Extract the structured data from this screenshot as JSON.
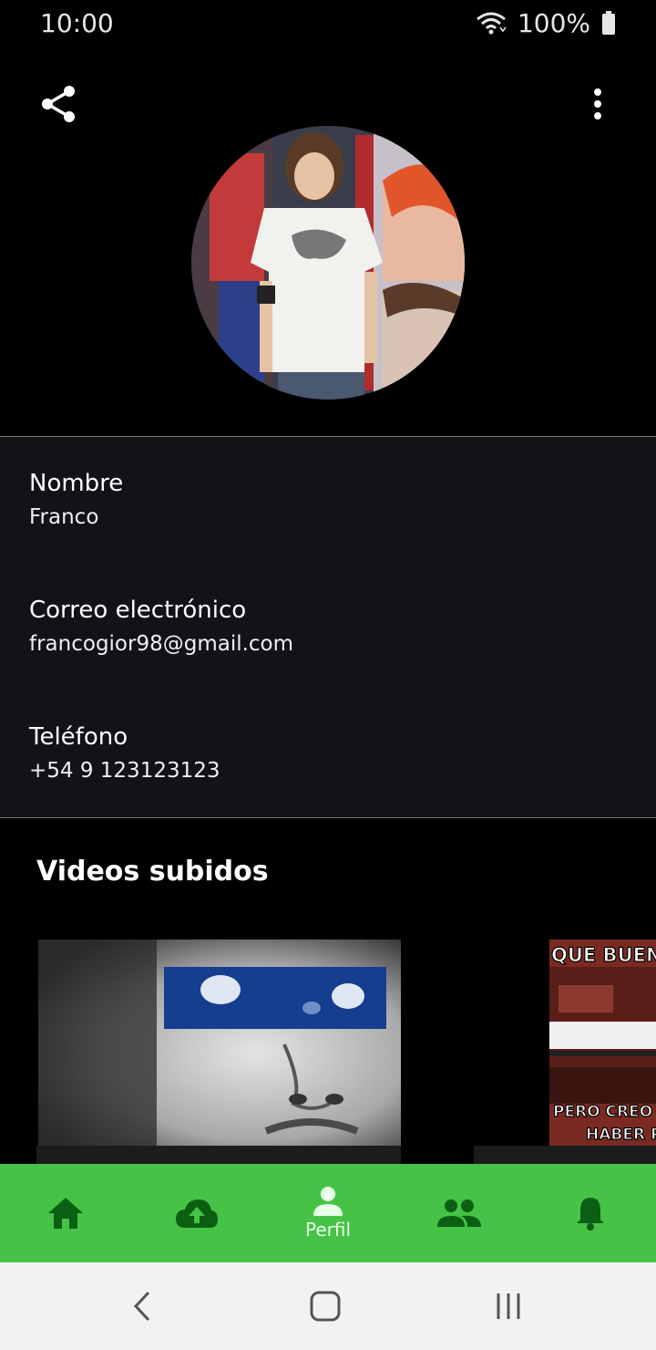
{
  "status_bar": {
    "time": "10:00",
    "battery": "100%"
  },
  "profile": {
    "fields": [
      {
        "label": "Nombre",
        "value": "Franco"
      },
      {
        "label": "Correo electrónico",
        "value": "francogior98@gmail.com"
      },
      {
        "label": "Teléfono",
        "value": "+54 9 123123123"
      }
    ]
  },
  "videos": {
    "title": "Videos subidos",
    "items": [
      {
        "caption_top": "",
        "caption_bottom": ""
      },
      {
        "caption_top": "QUE BUEN D",
        "caption_bottom": "PERO CREO QUI",
        "caption_bottom2": "HABER PR"
      }
    ]
  },
  "bottom_nav": {
    "items": [
      {
        "icon": "home-icon",
        "label": ""
      },
      {
        "icon": "cloud-upload-icon",
        "label": ""
      },
      {
        "icon": "person-icon",
        "label": "Perfil"
      },
      {
        "icon": "people-icon",
        "label": ""
      },
      {
        "icon": "bell-icon",
        "label": ""
      }
    ],
    "active_index": 2
  },
  "colors": {
    "nav_background": "#46c347",
    "nav_icon": "#0a5f12",
    "nav_active": "#e8ffe8",
    "panel_background": "#111318"
  }
}
